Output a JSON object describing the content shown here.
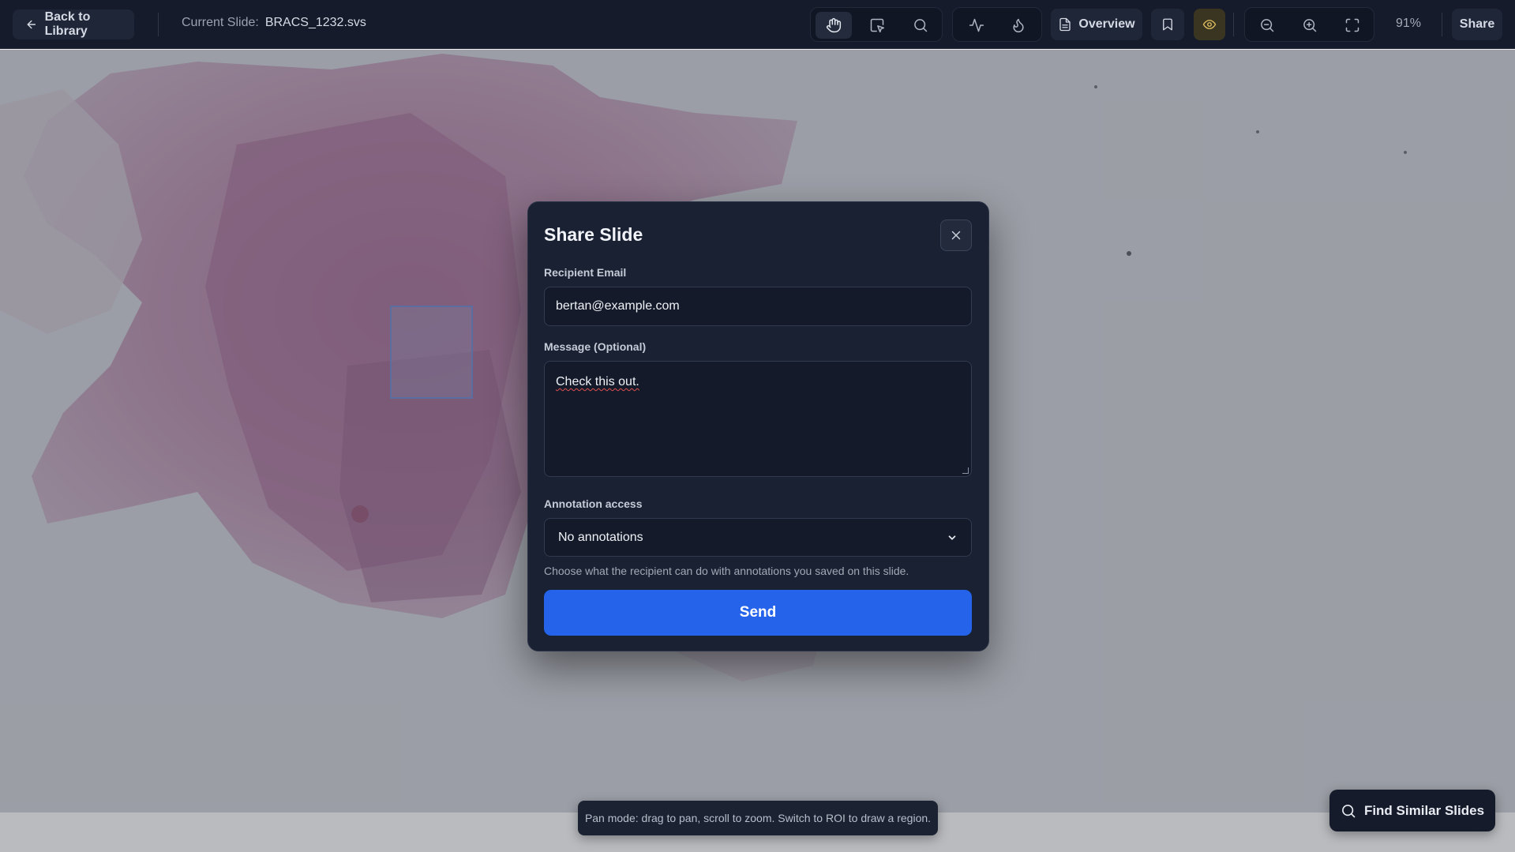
{
  "topbar": {
    "back_label": "Back to Library",
    "current_slide_label": "Current Slide:",
    "current_slide_value": "BRACS_1232.svs",
    "overview_label": "Overview",
    "zoom_level": "91%",
    "share_label": "Share",
    "tools": [
      "hand-icon",
      "roi-select-icon",
      "search-icon",
      "activity-icon",
      "flame-icon",
      "document-icon",
      "bookmark-icon",
      "eye-icon",
      "zoom-out-icon",
      "zoom-in-icon",
      "fullscreen-icon"
    ]
  },
  "modal": {
    "title": "Share Slide",
    "email_label": "Recipient Email",
    "email_value": "bertan@example.com",
    "message_label": "Message (Optional)",
    "message_value": "Check this out.",
    "access_label": "Annotation access",
    "access_selected": "No annotations",
    "access_hint": "Choose what the recipient can do with annotations you saved on this slide.",
    "send_label": "Send"
  },
  "toast": {
    "text": "Pan mode: drag to pan, scroll to zoom. Switch to ROI to draw a region."
  },
  "find_similar": {
    "label": "Find Similar Slides"
  },
  "colors": {
    "topbar_bg": "#151b2b",
    "accent_blue": "#2563eb",
    "eye_active": "#e0c062",
    "tissue_pink": "#c98aa8"
  }
}
